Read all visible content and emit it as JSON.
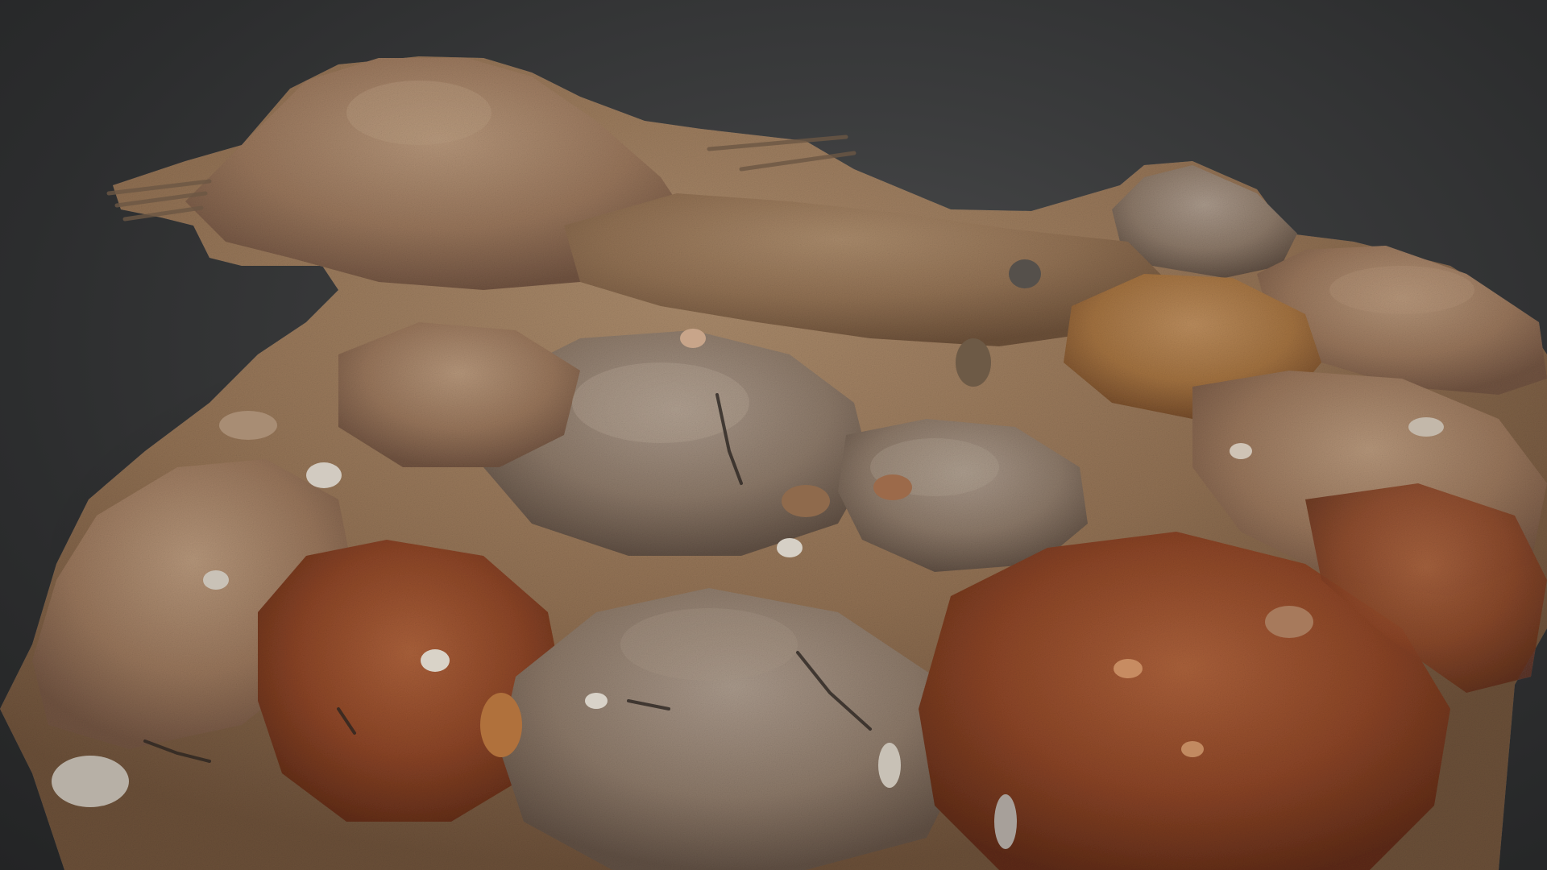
{
  "scene": {
    "subject": "soil-and-gravel-mound-3d-scan",
    "colors": {
      "background": "#3a3b3c",
      "soil_light": "#a88766",
      "soil_mid": "#8c6a4b",
      "soil_dark": "#5e4430",
      "rust": "#9a4a28",
      "rust_dark": "#6e3018",
      "stone_light": "#cfc7bc",
      "stone_mid": "#9a8f84",
      "stone_dark": "#4f4740"
    }
  }
}
